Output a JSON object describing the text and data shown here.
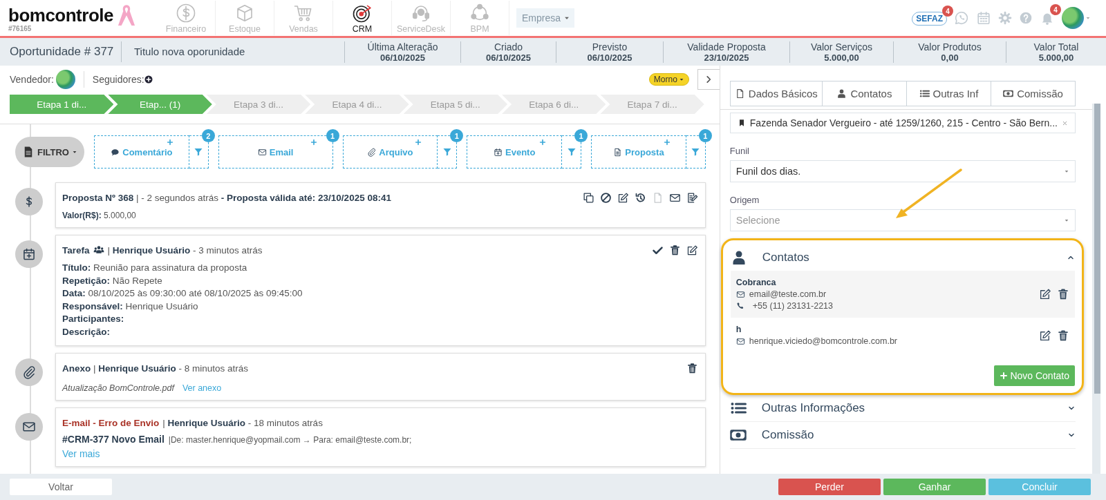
{
  "nav": {
    "logo": "bomcontrole",
    "account": "#76165",
    "modules": [
      {
        "label": "Financeiro",
        "kind": "finance",
        "selected": false
      },
      {
        "label": "Estoque",
        "kind": "stock",
        "selected": false
      },
      {
        "label": "Vendas",
        "kind": "sales",
        "selected": false
      },
      {
        "label": "CRM",
        "kind": "crm",
        "selected": true
      },
      {
        "label": "ServiceDesk",
        "kind": "servicedesk",
        "selected": false
      },
      {
        "label": "BPM",
        "kind": "bpm",
        "selected": false
      }
    ],
    "company_select": {
      "placeholder": "Empresa"
    },
    "sefaz": {
      "label": "SEFAZ",
      "badge": "4"
    },
    "notifications": {
      "badge": "4"
    }
  },
  "header": {
    "title": "Oportunidade # 377",
    "name": "Titulo nova oporunidade",
    "fields": [
      {
        "label": "Última Alteração",
        "value": "06/10/2025"
      },
      {
        "label": "Criado",
        "value": "06/10/2025"
      },
      {
        "label": "Previsto",
        "value": "06/10/2025"
      },
      {
        "label": "Validade Proposta",
        "value": "23/10/2025"
      },
      {
        "label": "Valor Serviços",
        "value": "5.000,00"
      },
      {
        "label": "Valor Produtos",
        "value": "0,00"
      },
      {
        "label": "Valor Total",
        "value": "5.000,00"
      }
    ]
  },
  "owner": {
    "label": "Vendedor:"
  },
  "followers": {
    "label": "Seguidores:"
  },
  "temperature": {
    "label": "Morno"
  },
  "stages": [
    {
      "label": "Etapa 1 di...",
      "done": true
    },
    {
      "label": "Etap... (1)",
      "done": true
    },
    {
      "label": "Etapa 3 di...",
      "done": false
    },
    {
      "label": "Etapa 4 di...",
      "done": false
    },
    {
      "label": "Etapa 5 di...",
      "done": false
    },
    {
      "label": "Etapa 6 di...",
      "done": false
    },
    {
      "label": "Etapa 7 di...",
      "done": false
    }
  ],
  "activity_filter": {
    "label": "FILTRO",
    "types": [
      {
        "kind": "comment",
        "label": "Comentário",
        "count": "2",
        "filterable": true
      },
      {
        "kind": "email",
        "label": "Email",
        "count": "1",
        "filterable": false
      },
      {
        "kind": "file",
        "label": "Arquivo",
        "count": "1",
        "filterable": true
      },
      {
        "kind": "event",
        "label": "Evento",
        "count": "1",
        "filterable": true
      },
      {
        "kind": "proposal",
        "label": "Proposta",
        "count": "1",
        "filterable": true
      }
    ]
  },
  "timeline": [
    {
      "kind": "proposal",
      "header": "**Proposta Nº 368** | - 2 segundos atrás **- Proposta válida até: 23/10/2025 08:41**",
      "details": [
        {
          "label": "Valor(R$):",
          "value": "5.000,00"
        }
      ]
    },
    {
      "kind": "task",
      "title": "Tarefa",
      "header": "| **Henrique Usuário** - 3 minutos atrás",
      "details": [
        {
          "label": "Título:",
          "value": "Reunião para assinatura da proposta"
        },
        {
          "label": "Repetição:",
          "value": "Não Repete"
        },
        {
          "label": "Data:",
          "value": "08/10/2025 às 09:30:00 até 08/10/2025 às 09:45:00"
        },
        {
          "label": "Responsável:",
          "value": "Henrique Usuário"
        },
        {
          "label": "Participantes:"
        },
        {
          "label": "Descrição:"
        }
      ]
    },
    {
      "kind": "attachment",
      "header": "**Anexo** | **Henrique Usuário** - 8 minutos atrás",
      "file": "Atualização BomControle.pdf",
      "link": "Ver anexo"
    },
    {
      "kind": "email",
      "status": "E-mail - Erro de Envio",
      "header": "| **Henrique Usuário** - 18 minutos atrás",
      "subject": "#CRM-377 Novo Email",
      "meta": "|De: master.henrique@yopmail.com → Para: email@teste.com.br;",
      "link": "Ver mais"
    }
  ],
  "details_panel": {
    "tabs": [
      {
        "kind": "basic",
        "label": "Dados Básicos"
      },
      {
        "kind": "contacts",
        "label": "Contatos"
      },
      {
        "kind": "other",
        "label": "Outras Inf"
      },
      {
        "kind": "commission",
        "label": "Comissão"
      }
    ],
    "address": {
      "value": "Fazenda Senador Vergueiro - até 1259/1260, 215 - Centro - São Bern..."
    },
    "fields": [
      {
        "label": "Funil",
        "value": "Funil dos dias."
      },
      {
        "label": "Origem",
        "placeholder": "Selecione"
      }
    ],
    "sections": [
      {
        "kind": "contacts",
        "title": "Contatos",
        "expanded": true,
        "highlighted": true,
        "contacts": [
          {
            "name": "Cobranca",
            "email": "email@teste.com.br",
            "phone": "+55 (11) 23131-2213"
          },
          {
            "name": "h",
            "email": "henrique.viciedo@bomcontrole.com.br"
          }
        ],
        "add_button": "Novo Contato"
      },
      {
        "kind": "other",
        "title": "Outras Informações",
        "expanded": false,
        "highlighted": false
      },
      {
        "kind": "commission",
        "title": "Comissão",
        "expanded": false,
        "highlighted": false
      }
    ]
  },
  "footer": {
    "back": "Voltar",
    "actions": [
      {
        "kind": "danger",
        "label": "Perder"
      },
      {
        "kind": "success",
        "label": "Ganhar"
      },
      {
        "kind": "info",
        "label": "Concluir"
      }
    ]
  }
}
